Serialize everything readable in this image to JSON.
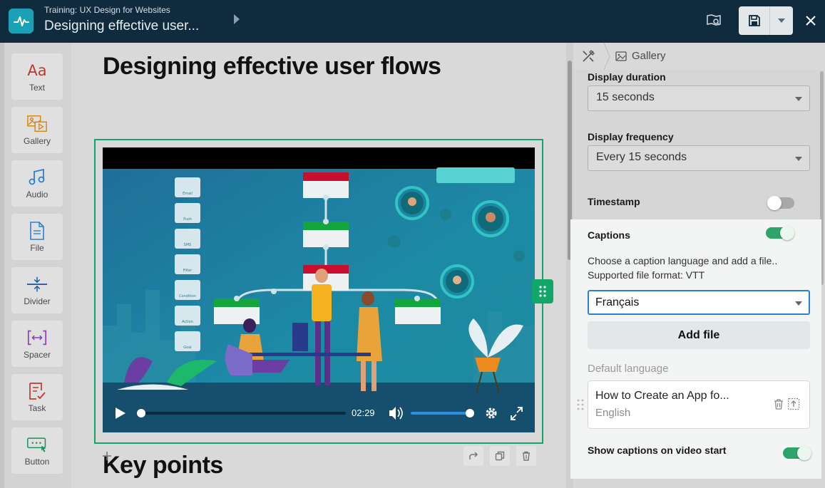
{
  "topbar": {
    "course": "Training: UX Design for Websites",
    "lesson": "Designing effective user...",
    "icons": [
      "logo-icon",
      "chevron-right-icon",
      "preview-icon",
      "save-icon",
      "chevron-down-icon",
      "close-icon"
    ]
  },
  "palette": {
    "items": [
      {
        "label": "Text",
        "icon": "text-icon"
      },
      {
        "label": "Gallery",
        "icon": "gallery-icon"
      },
      {
        "label": "Audio",
        "icon": "audio-icon"
      },
      {
        "label": "File",
        "icon": "file-icon"
      },
      {
        "label": "Divider",
        "icon": "divider-icon"
      },
      {
        "label": "Spacer",
        "icon": "spacer-icon"
      },
      {
        "label": "Task",
        "icon": "task-icon"
      },
      {
        "label": "Button",
        "icon": "button-icon"
      }
    ],
    "text_glyph": "Aa"
  },
  "canvas": {
    "heading": "Designing effective user flows",
    "next_heading": "Key points",
    "video": {
      "time": "02:29",
      "progress": 0.0,
      "volume": 0.95,
      "flow_labels": [
        "Email",
        "Push",
        "SMS",
        "Filter",
        "Condition",
        "Action",
        "Goal"
      ]
    }
  },
  "panel": {
    "breadcrumb": "Gallery",
    "display_duration_label": "Display duration",
    "display_duration_value": "15 seconds",
    "display_frequency_label": "Display frequency",
    "display_frequency_value": "Every 15 seconds",
    "timestamp_label": "Timestamp",
    "timestamp_on": false,
    "captions_label": "Captions",
    "captions_on": true,
    "help_line1": "Choose a caption language and add a file..",
    "help_line2": "Supported file format: VTT",
    "language_value": "Français",
    "add_file": "Add file",
    "default_language_label": "Default language",
    "caption_file_title": "How to Create an App fo...",
    "caption_file_language": "English",
    "show_on_start_label": "Show captions on video start",
    "show_on_start_on": true
  },
  "colors": {
    "topbar": "#0f2b3d",
    "accent_green": "#13a66a",
    "toggle_on": "#2ea36a",
    "focus_blue": "#2b7fd6"
  }
}
